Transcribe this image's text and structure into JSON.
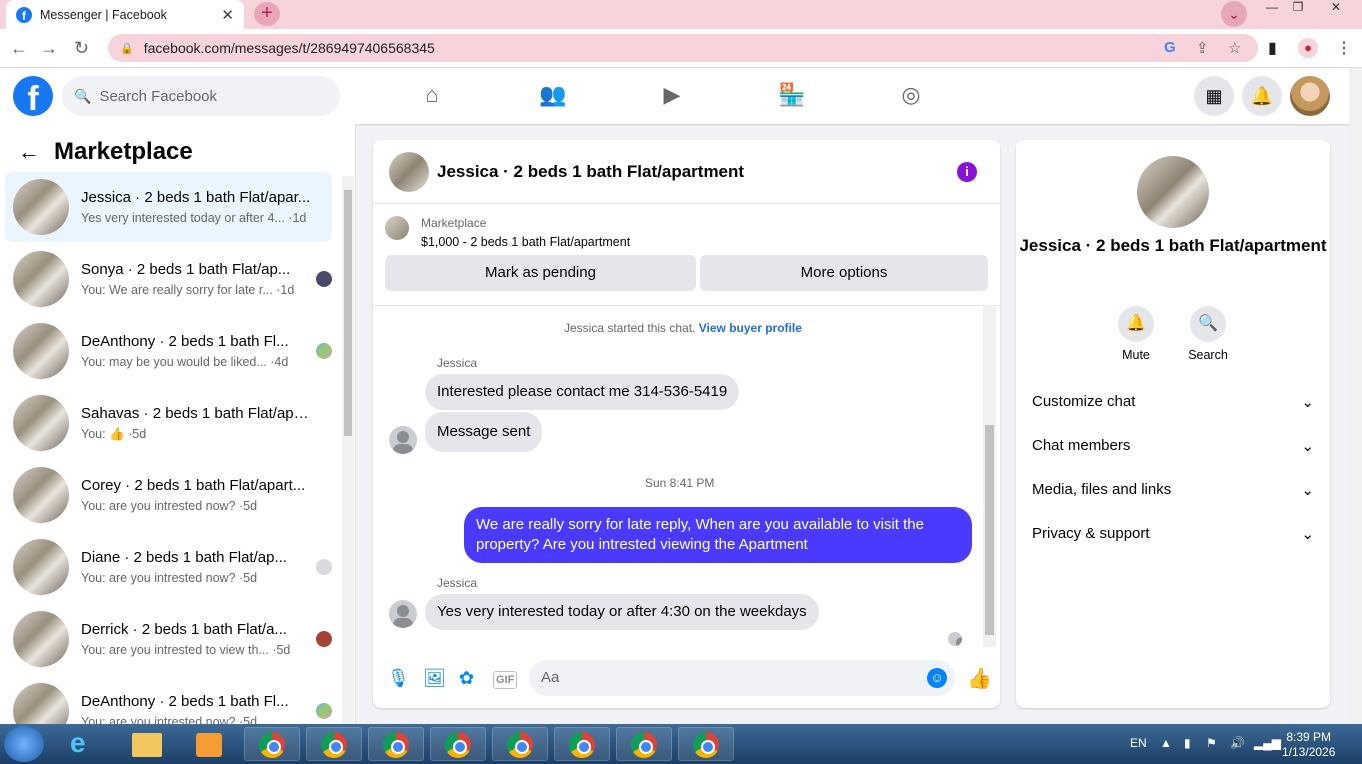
{
  "browser": {
    "tab_title": "Messenger | Facebook",
    "tab_close": "✕",
    "new_tab": "+",
    "url": "facebook.com/messages/t/2869497406568345"
  },
  "fb": {
    "logo": "f",
    "search_placeholder": "Search Facebook",
    "nav_icons": [
      "home-icon",
      "friends-icon",
      "watch-icon",
      "marketplace-icon",
      "groups-icon"
    ]
  },
  "sidebar": {
    "title": "Marketplace",
    "conversations": [
      {
        "name": "Jessica · 2 beds 1 bath Flat/apar...",
        "preview": "Yes very interested today or after 4... ·1d",
        "active": true
      },
      {
        "name": "Sonya · 2 beds 1 bath Flat/ap...",
        "preview": "You: We are really sorry for late r... ·1d"
      },
      {
        "name": "DeAnthony · 2 beds 1 bath Fl...",
        "preview": "You: may be you would be liked... ·4d"
      },
      {
        "name": "Sahavas · 2 beds 1 bath Flat/apa...",
        "preview": "You: 👍 ·5d"
      },
      {
        "name": "Corey · 2 beds 1 bath Flat/apart...",
        "preview": "You: are you intrested now? ·5d"
      },
      {
        "name": "Diane · 2 beds 1 bath Flat/ap...",
        "preview": "You: are you intrested now? ·5d"
      },
      {
        "name": "Derrick · 2 beds 1 bath Flat/a...",
        "preview": "You: are you intrested to view th... ·5d"
      },
      {
        "name": "DeAnthony · 2 beds 1 bath Fl...",
        "preview": "You: are you intrested now? ·5d"
      }
    ]
  },
  "chat": {
    "title": "Jessica · 2 beds 1 bath Flat/apartment",
    "info": "i",
    "marketplace_label": "Marketplace",
    "listing": "$1,000 - 2 beds 1 bath Flat/apartment",
    "mark_pending": "Mark as pending",
    "more_options": "More options",
    "started": "Jessica started this chat.",
    "view_profile": "View buyer profile",
    "sender1": "Jessica",
    "msg1": "Interested please contact me 314-536-5419",
    "msg2": "Message sent",
    "timestamp": "Sun 8:41 PM",
    "msg3": "We are really sorry for late reply, When are you available to visit the property? Are you intrested viewing the Apartment",
    "sender2": "Jessica",
    "msg4": "Yes very interested today or after 4:30 on the weekdays",
    "composer_placeholder": "Aa",
    "gif": "GIF"
  },
  "details": {
    "name": "Jessica · 2 beds 1 bath Flat/apartment",
    "mute": "Mute",
    "search": "Search",
    "items": [
      "Customize chat",
      "Chat members",
      "Media, files and links",
      "Privacy & support"
    ]
  },
  "taskbar": {
    "lang": "EN",
    "time": "8:39 PM",
    "date": "1/13/2026"
  }
}
